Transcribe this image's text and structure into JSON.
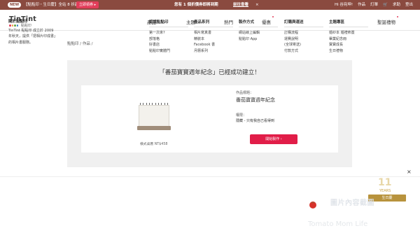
{
  "topbar": {
    "new_badge": "NEW",
    "promo_text": "【點點印・生日慶】全站 8 折起！",
    "promo_button": "立即領券 ▸",
    "center_message": "您有 1 個折價券即將到期",
    "center_link": "前往查看",
    "center_close": "×",
    "right_links": [
      "Hi 谷宛坤!",
      "作品",
      "訂單",
      "🛒",
      "求助",
      "登出"
    ]
  },
  "header": {
    "brand": "TinTint",
    "brand_sub": "點點印",
    "logo_dot_colors": [
      "#e23d5a",
      "#f2a640",
      "#6aa84f",
      "#3d85c6"
    ],
    "nav": [
      "產品",
      "主題",
      "熱門",
      "優惠",
      "聖誕禮物"
    ]
  },
  "breadcrumb": "點點印 / 作品 /",
  "main": {
    "success_title": "「番茄寶寶週年紀念」已經成功建立！",
    "product_name": "橫式桌曆 NT$458",
    "work_title_label": "作品標題：",
    "work_title_value": "番茄寶寶週年紀念",
    "permission_label": "權限：",
    "permission_value": "隱藏 - 只有我自己看得到",
    "start_button": "開始製作 ›"
  },
  "float_close": "×",
  "footer": {
    "about_heading": "關於點點印",
    "about_text": "TinTint 點點印 成立於 2009 年秋天，提供「把相片印成書」的相片書服務。",
    "columns": [
      {
        "heading": "認識點點印",
        "items": [
          "第一次來?",
          "部落格",
          "好書店",
          "點點印實體門"
        ]
      },
      {
        "heading": "產品系列",
        "items": [
          "相片寫真書",
          "精裝本",
          "Facebook 書",
          "月曆系列"
        ]
      },
      {
        "heading": "製作方式",
        "items": [
          "網站線上編輯",
          "點點印 App",
          ""
        ]
      },
      {
        "heading": "訂購與運送",
        "items": [
          "訂購流程",
          "運費說明",
          "(全球寄送)",
          "付款方式"
        ]
      },
      {
        "heading": "主題專區",
        "items": [
          "婚紗本 婚禮佈置",
          "畢業紀念冊",
          "寶寶成長",
          "生日禮物"
        ]
      }
    ],
    "badge_number": "11",
    "badge_year": "YEARS",
    "badge_ribbon": "生日慶",
    "watermark_text": "圖片內容截圖",
    "watermark_text2": "Tomato Mom Life"
  }
}
